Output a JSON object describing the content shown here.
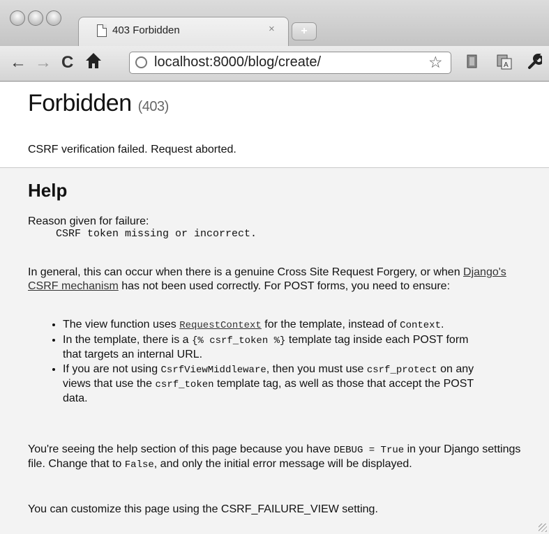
{
  "browser": {
    "tab_title": "403 Forbidden",
    "tab_close": "×",
    "new_tab": "+",
    "url": "localhost:8000/blog/create/",
    "icons": [
      "back-icon",
      "forward-icon",
      "reload-icon",
      "home-icon",
      "globe-icon",
      "bookmark-star-icon",
      "page-action-icon",
      "translate-icon",
      "wrench-icon"
    ]
  },
  "summary": {
    "title": "Forbidden",
    "code": "(403)",
    "message": "CSRF verification failed. Request aborted."
  },
  "help": {
    "heading": "Help",
    "reason_label": "Reason given for failure:",
    "reason": "CSRF token missing or incorrect.",
    "intro_1": "In general, this can occur when there is a genuine Cross Site Request Forgery, or when ",
    "intro_link": "Django's CSRF mechanism",
    "intro_2": " has not been used correctly. For POST forms, you need to ensure:",
    "item1_a": "The view function uses ",
    "item1_link": "RequestContext",
    "item1_b": " for the template, instead of ",
    "item1_code": "Context",
    "item1_c": ".",
    "item2_a": "In the template, there is a ",
    "item2_code": "{% csrf_token %}",
    "item2_b": " template tag inside each POST form that targets an internal URL.",
    "item3_a": "If you are not using ",
    "item3_code1": "CsrfViewMiddleware",
    "item3_b": ", then you must use ",
    "item3_code2": "csrf_protect",
    "item3_c": " on any views that use the ",
    "item3_code3": "csrf_token",
    "item3_d": " template tag, as well as those that accept the POST data.",
    "debug_a": "You're seeing the help section of this page because you have ",
    "debug_code1": "DEBUG = True",
    "debug_b": " in your Django settings file. Change that to ",
    "debug_code2": "False",
    "debug_c": ", and only the initial error message will be displayed.",
    "customize": "You can customize this page using the CSRF_FAILURE_VIEW setting."
  }
}
